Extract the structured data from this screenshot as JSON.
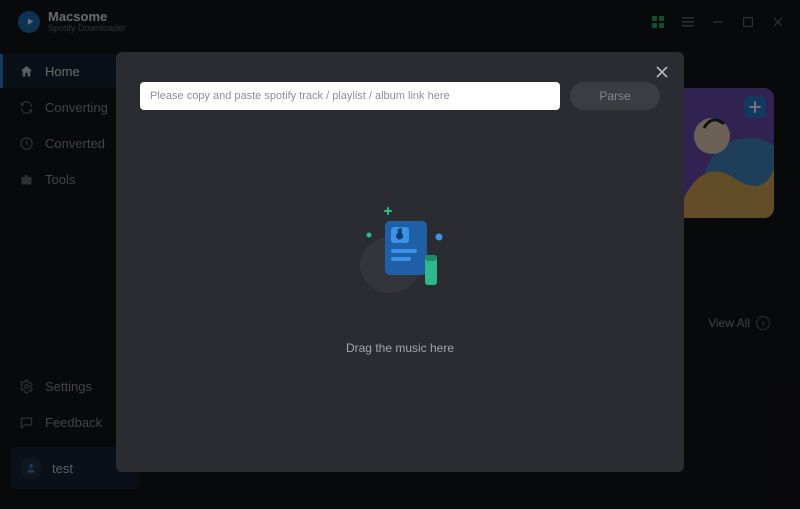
{
  "brand": {
    "title": "Macsome",
    "sub": "Spotify Downloader"
  },
  "nav": {
    "home": "Home",
    "converting": "Converting",
    "converted": "Converted",
    "tools": "Tools",
    "settings": "Settings",
    "feedback": "Feedback",
    "user": "test"
  },
  "main": {
    "view_all": "View All"
  },
  "modal": {
    "placeholder": "Please copy and paste spotify track / playlist / album link here",
    "parse": "Parse",
    "drop_hint": "Drag the music here"
  }
}
